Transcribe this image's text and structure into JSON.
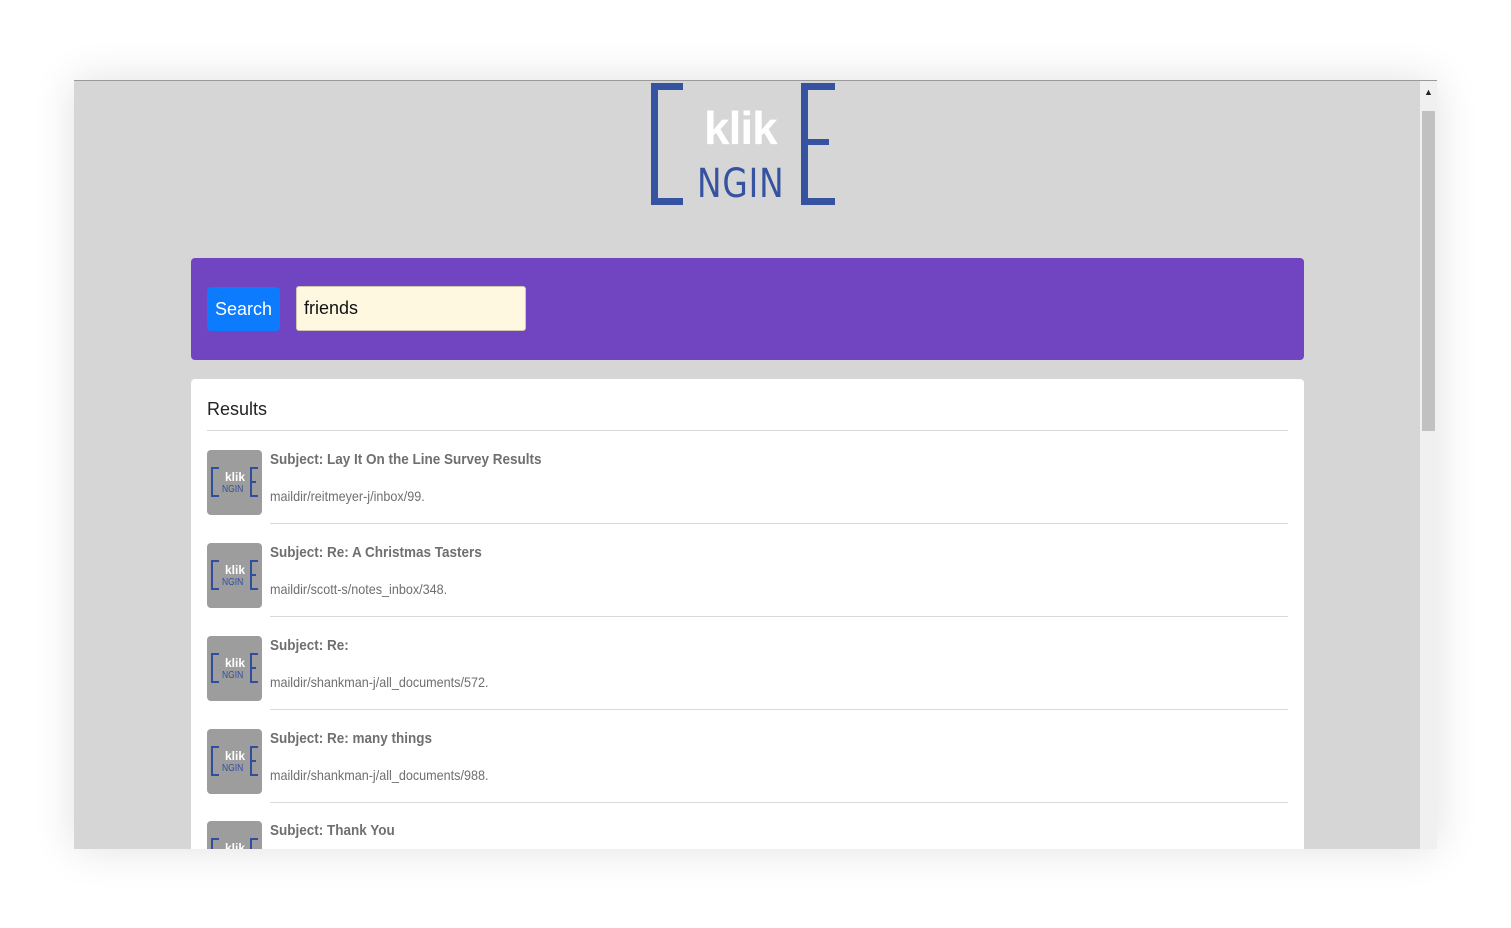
{
  "logo": {
    "text_top": "klik",
    "text_bottom": "NGIN",
    "letter": "E",
    "color": "#3553a1"
  },
  "search": {
    "button_label": "Search",
    "query": "friends",
    "panel_color": "#7144c1",
    "button_color": "#0d7bfd"
  },
  "results": {
    "title": "Results",
    "items": [
      {
        "subject": "Subject: Lay It On the Line Survey Results",
        "path": "maildir/reitmeyer-j/inbox/99."
      },
      {
        "subject": "Subject: Re: A Christmas Tasters",
        "path": "maildir/scott-s/notes_inbox/348."
      },
      {
        "subject": "Subject: Re:",
        "path": "maildir/shankman-j/all_documents/572."
      },
      {
        "subject": "Subject: Re: many things",
        "path": "maildir/shankman-j/all_documents/988."
      },
      {
        "subject": "Subject: Thank You",
        "path": ""
      }
    ]
  }
}
